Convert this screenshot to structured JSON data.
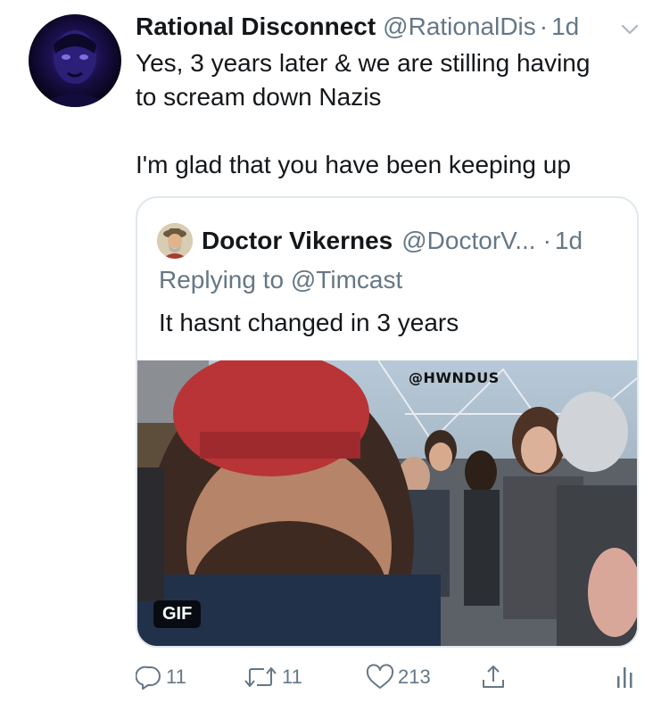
{
  "tweet": {
    "display_name": "Rational Disconnect",
    "handle": "@RationalDis",
    "separator": "·",
    "time": "1d",
    "text": "Yes, 3 years later & we are stilling having\nto scream down Nazis\n\nI'm glad that you have been keeping up"
  },
  "quote": {
    "display_name": "Doctor Vikernes",
    "handle": "@DoctorV...",
    "separator": "·",
    "time": "1d",
    "replying_to": "Replying to @Timcast",
    "text": "It hasnt changed in 3 years",
    "media": {
      "badge": "GIF",
      "watermark": "@HWNDUS"
    }
  },
  "actions": {
    "reply_count": "11",
    "retweet_count": "11",
    "like_count": "213"
  },
  "icons": {
    "caret": "chevron-down-icon",
    "reply": "reply-icon",
    "retweet": "retweet-icon",
    "like": "heart-icon",
    "share": "share-icon",
    "analytics": "analytics-icon"
  },
  "colors": {
    "text": "#14171a",
    "secondary": "#657786",
    "border": "#e1e8ed"
  }
}
